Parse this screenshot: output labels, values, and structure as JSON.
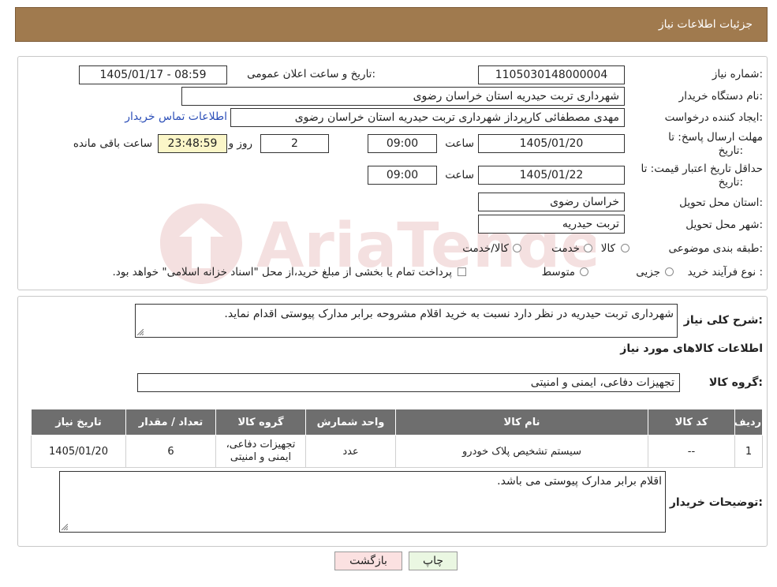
{
  "header": {
    "title": "جزئیات اطلاعات نیاز"
  },
  "fields": {
    "need_number_label": "شماره نیاز:",
    "need_number": "1105030148000004",
    "announce_label": "تاریخ و ساعت اعلان عمومی:",
    "announce_value": "1405/01/17 - 08:59",
    "buyer_org_label": "نام دستگاه خریدار:",
    "buyer_org": "شهرداری تربت حیدریه استان خراسان رضوی",
    "creator_label": "ایجاد کننده درخواست:",
    "creator": "مهدی مصطفائی کارپرداز شهرداری تربت حیدریه استان خراسان رضوی",
    "contact_link": "اطلاعات تماس خریدار",
    "deadline_label_1": "مهلت ارسال پاسخ: تا",
    "deadline_label_2": "تاریخ:",
    "deadline_date": "1405/01/20",
    "time_label": "ساعت",
    "deadline_time": "09:00",
    "days_value": "2",
    "days_label": "روز و",
    "remaining_time": "23:48:59",
    "remaining_label": "ساعت باقی مانده",
    "validity_label_1": "حداقل تاریخ اعتبار قیمت: تا",
    "validity_label_2": "تاریخ:",
    "validity_date": "1405/01/22",
    "validity_time": "09:00",
    "province_label": "استان محل تحویل:",
    "province": "خراسان رضوی",
    "city_label": "شهر محل تحویل:",
    "city": "تربت حیدریه",
    "category_label": "طبقه بندی موضوعی:",
    "category_options": [
      "کالا",
      "خدمت",
      "کالا/خدمت"
    ],
    "process_label": "نوع فرآیند خرید :",
    "process_options": [
      "جزیی",
      "متوسط"
    ],
    "process_note": "پرداخت تمام یا بخشی از مبلغ خرید،از محل \"اسناد خزانه اسلامی\" خواهد بود."
  },
  "description": {
    "label": "شرح کلی نیاز:",
    "text": "شهرداری تربت حیدریه در نظر دارد نسبت به خرید اقلام مشروحه برابر مدارک پیوستی اقدام نماید."
  },
  "goods": {
    "section_title": "اطلاعات کالاهای مورد نیاز",
    "group_label": "گروه کالا:",
    "group_value": "تجهیزات دفاعی، ایمنی و امنیتی",
    "columns": [
      "ردیف",
      "کد کالا",
      "نام کالا",
      "واحد شمارش",
      "گروه کالا",
      "تعداد / مقدار",
      "تاریخ نیاز"
    ],
    "rows": [
      [
        "1",
        "--",
        "سیستم تشخیص پلاک خودرو",
        "عدد",
        "تجهیزات دفاعی، ایمنی و امنیتی",
        "6",
        "1405/01/20"
      ]
    ]
  },
  "buyer_notes": {
    "label": "توضیحات خریدار:",
    "text": "اقلام برابر مدارک پیوستی می باشد."
  },
  "buttons": {
    "print": "چاپ",
    "back": "بازگشت"
  },
  "watermark_text": "AriaTender.neT",
  "colors": {
    "header": "#a07a4e",
    "table_header": "#6e6e6e",
    "link": "#2c4fb8",
    "back_button": "#fbe1e1",
    "print_button": "#eaf7e2",
    "remaining_bg": "#fbf6c8"
  }
}
